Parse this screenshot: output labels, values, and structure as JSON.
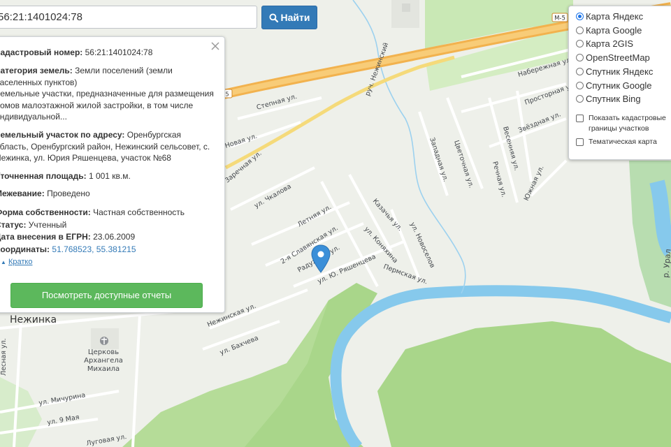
{
  "search": {
    "value": "56:21:1401024:78",
    "button_label": "Найти"
  },
  "info": {
    "cadastral_label": "Кадастровый номер:",
    "cadastral_value": "56:21:1401024:78",
    "category_label": "Категория земель:",
    "category_value": "Земли поселений (земли населенных пунктов)",
    "usage_text": "Земельные участки, предназначенные для размещения домов малоэтажной жилой застройки, в том числе индивидуальной...",
    "address_label": "Земельный участок по адресу:",
    "address_value": "Оренбургская область, Оренбургский район, Нежинский сельсовет, с. Нежинка, ул. Юрия Ряшенцева, участок №68",
    "area_label": "Уточненная площадь:",
    "area_value": "1 001 кв.м.",
    "survey_label": "Межевание:",
    "survey_value": "Проведено",
    "ownership_label": "Форма собственности:",
    "ownership_value": "Частная собственность",
    "status_label": "Статус:",
    "status_value": "Учтенный",
    "date_label": "Дата внесения в ЕГРН:",
    "date_value": "23.06.2009",
    "coords_label": "Координаты:",
    "coords_value": "51.768523, 55.381215",
    "brief_link": "Кратко",
    "report_button": "Посмотреть доступные отчеты"
  },
  "layers": {
    "options": [
      "Карта Яндекс",
      "Карта Google",
      "Карта 2GIS",
      "OpenStreetMap",
      "Спутник Яндекс",
      "Спутник Google",
      "Спутник Bing"
    ],
    "selected": "Карта Яндекс",
    "checkboxes": [
      "Показать кадастровые границы участков",
      "Тематическая карта"
    ]
  },
  "map": {
    "village": "Нежинка",
    "church": "Церковь Архангела Михаила",
    "road_badges": [
      "М-5",
      "М-5"
    ],
    "river_label": "р. Урал",
    "stream_label": "руч. Нежинский",
    "streets": [
      "Степная ул.",
      "Новая ул.",
      "Заречная ул.",
      "ул. Чкалова",
      "Летняя ул.",
      "2-я Славянская ул.",
      "Радужная ул.",
      "ул. Ю. Ряшенцева",
      "ул. Коняхина",
      "Казачья ул.",
      "ул. Новоселов",
      "Пермская ул.",
      "Нежинская ул.",
      "ул. Бахчева",
      "ул. Мичурина",
      "ул. 9 Мая",
      "Лесная ул.",
      "Луговая ул.",
      "Западная ул.",
      "Цветочная ул.",
      "Весенняя ул.",
      "Речная ул.",
      "Южная ул.",
      "Звёздная ул.",
      "Просторная ул.",
      "Набережная ул."
    ]
  },
  "colors": {
    "search_button": "#337ab7",
    "report_button": "#5cb85c",
    "forest": "#a9d68a",
    "water": "#86c9ec",
    "highway": "#f4b04f"
  }
}
